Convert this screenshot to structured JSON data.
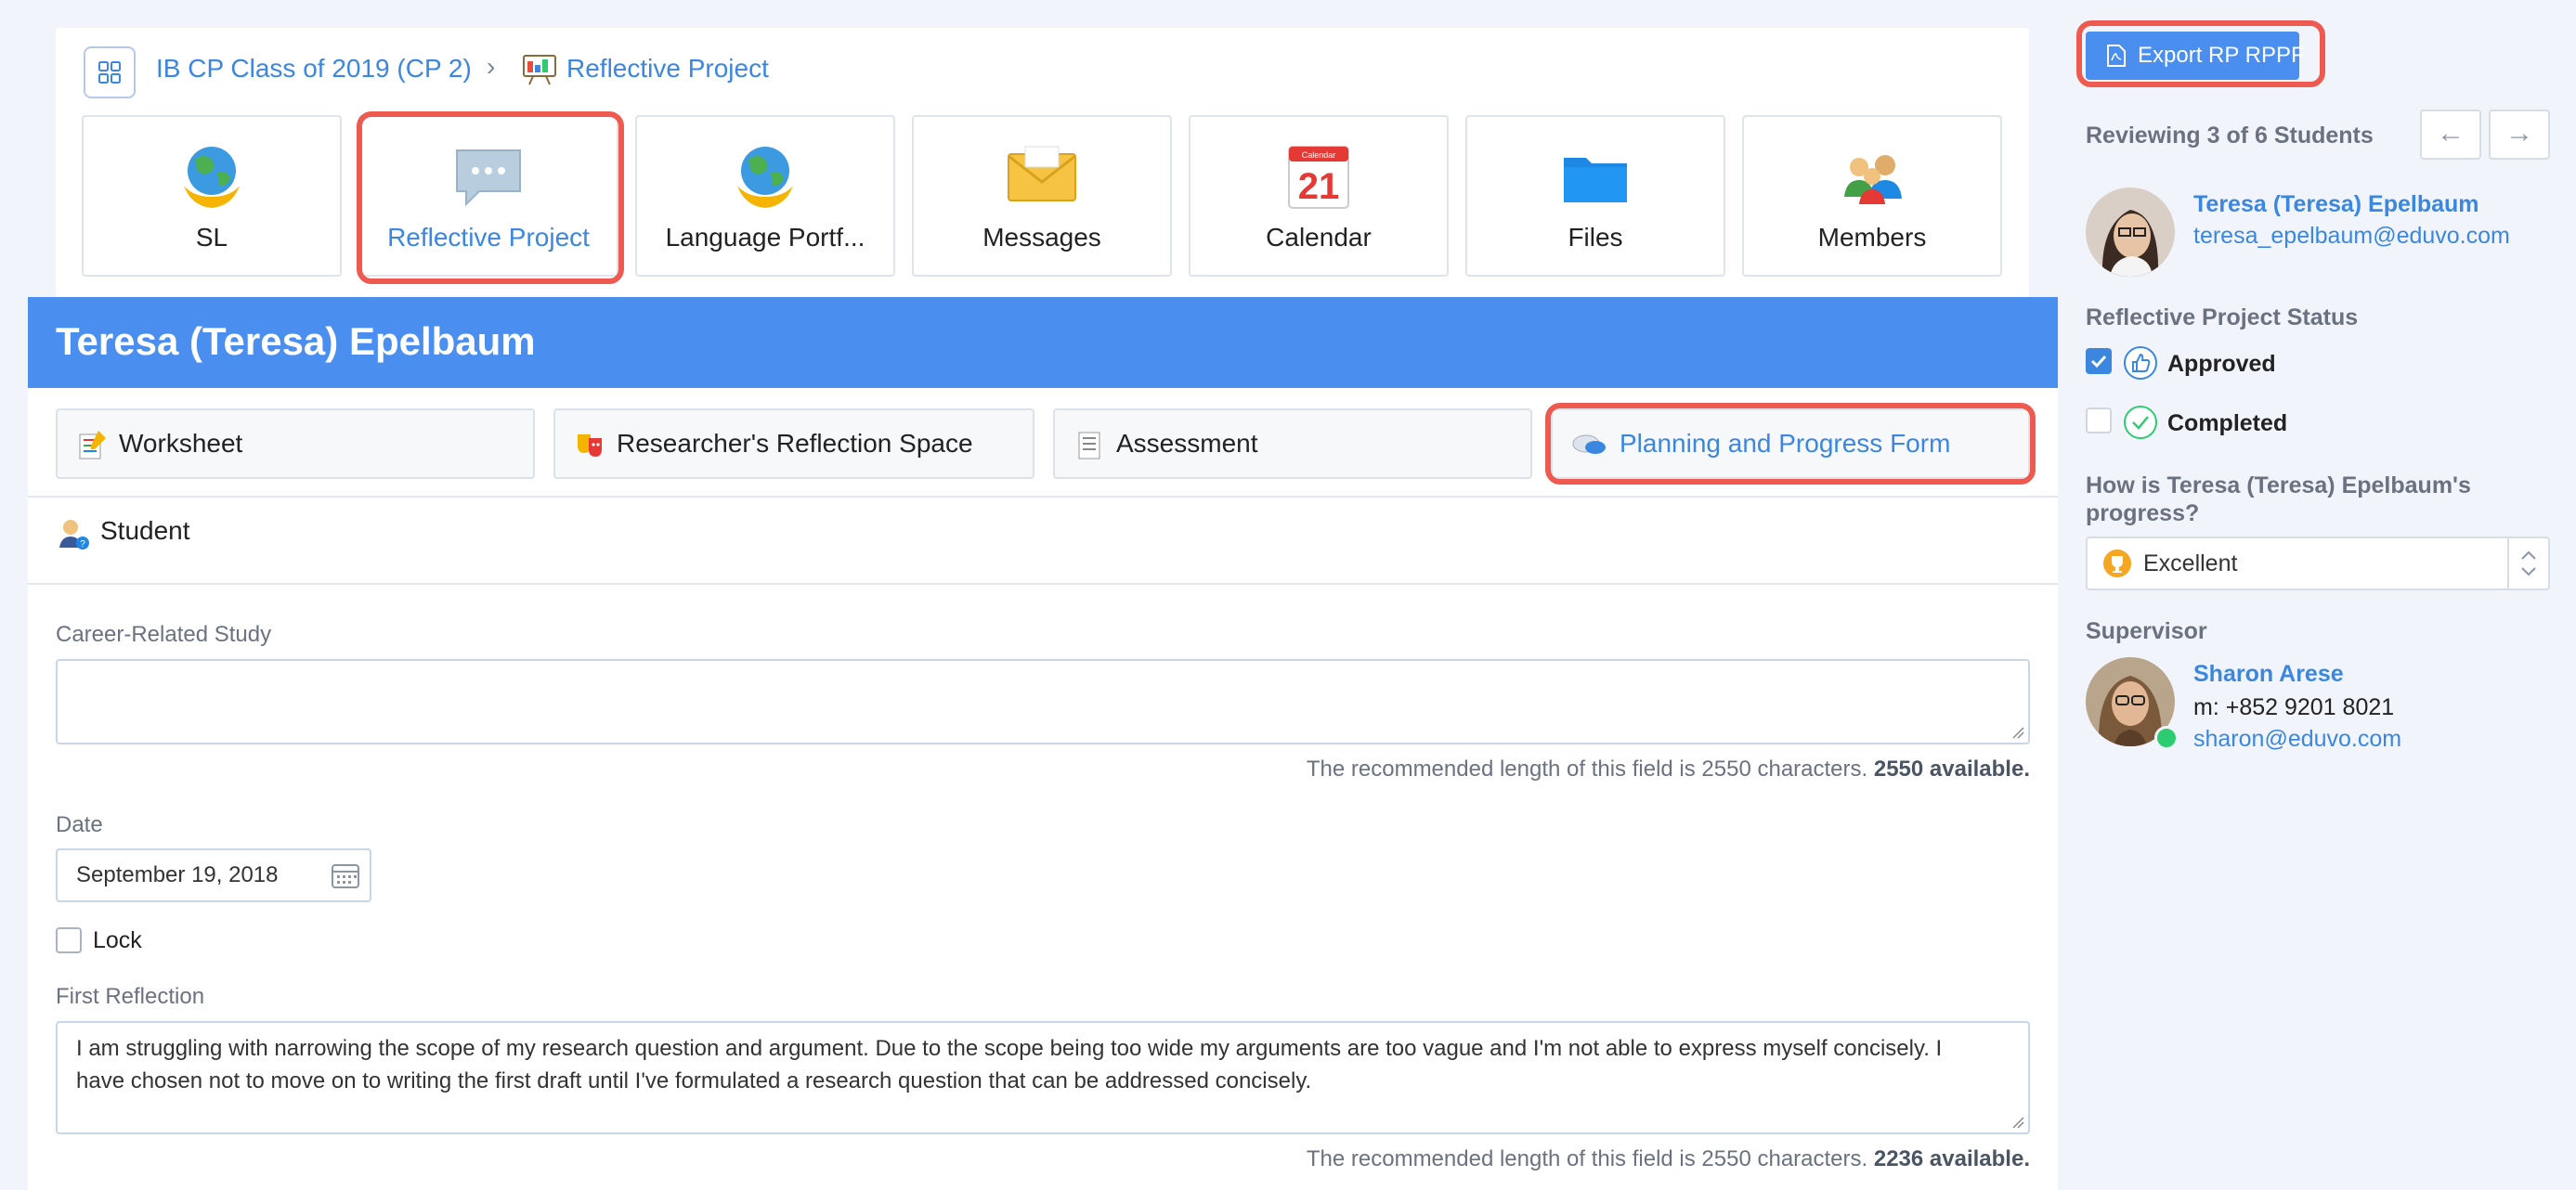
{
  "breadcrumb": {
    "class_name": "IB CP Class of 2019 (CP 2)",
    "separator": "›",
    "section": "Reflective Project"
  },
  "tiles": [
    {
      "label": "SL",
      "icon": "globe-hands-icon"
    },
    {
      "label": "Reflective Project",
      "icon": "speech-bubble-icon"
    },
    {
      "label": "Language Portf...",
      "icon": "globe-hands-icon"
    },
    {
      "label": "Messages",
      "icon": "envelope-icon"
    },
    {
      "label": "Calendar",
      "icon": "calendar-icon",
      "calendar_day": "21",
      "calendar_header": "Calendar"
    },
    {
      "label": "Files",
      "icon": "folder-icon"
    },
    {
      "label": "Members",
      "icon": "people-icon"
    }
  ],
  "student_header": "Teresa (Teresa) Epelbaum",
  "subtabs": [
    {
      "label": "Worksheet"
    },
    {
      "label": "Researcher's Reflection Space"
    },
    {
      "label": "Assessment"
    },
    {
      "label": "Planning and Progress Form"
    }
  ],
  "student_section_label": "Student",
  "form": {
    "career_label": "Career-Related Study",
    "career_value": "",
    "career_hint_prefix": "The recommended length of this field is 2550 characters.",
    "career_hint_available": "2550 available.",
    "date_label": "Date",
    "date_value": "September 19, 2018",
    "lock_label": "Lock",
    "reflection_label": "First Reflection",
    "reflection_value": "I am struggling with narrowing the scope of my research question and argument. Due to the scope being too wide my arguments are too vague and I'm not able to express myself concisely. I have chosen not to move on to writing the first draft until I've formulated a research question that can be addressed concisely.",
    "reflection_hint_prefix": "The recommended length of this field is 2550 characters.",
    "reflection_hint_available": "2236 available."
  },
  "sidebar": {
    "export_label": "Export RP RPPF",
    "reviewing": "Reviewing 3 of 6 Students",
    "prev_arrow": "←",
    "next_arrow": "→",
    "student_name": "Teresa (Teresa) Epelbaum",
    "student_email": "teresa_epelbaum@eduvo.com",
    "status_heading": "Reflective Project Status",
    "status_approved": "Approved",
    "status_completed": "Completed",
    "approved_checked": true,
    "completed_checked": false,
    "progress_question": "How is Teresa (Teresa) Epelbaum's progress?",
    "progress_value": "Excellent",
    "supervisor_heading": "Supervisor",
    "supervisor_name": "Sharon Arese",
    "supervisor_phone": "m: +852 9201 8021",
    "supervisor_email": "sharon@eduvo.com"
  },
  "colors": {
    "accent": "#4a8ef0",
    "link": "#3b87e0",
    "highlight": "#ee5a4f",
    "online": "#2ecc71"
  }
}
